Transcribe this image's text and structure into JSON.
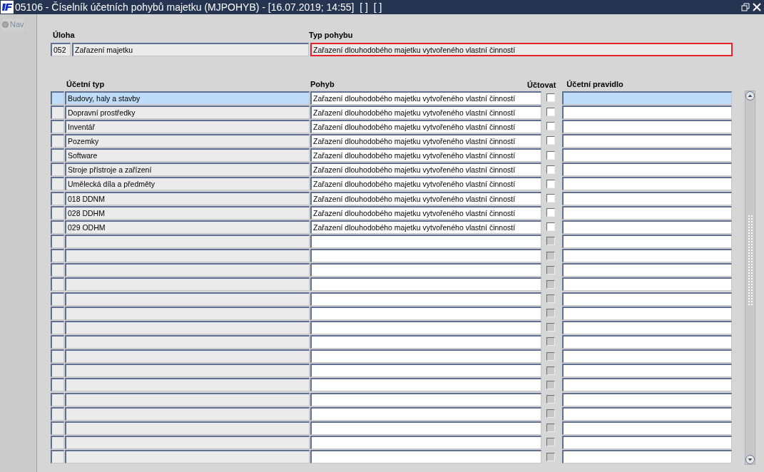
{
  "window": {
    "title": "05106 - Číselník účetních pohybů majetku (MJPOHYB) - [16.07.2019; 14:55]  [ ]  [ ]"
  },
  "sidebar": {
    "nav": {
      "label": "Nav",
      "selected": false
    }
  },
  "header": {
    "uloha_label": "Úloha",
    "uloha_code": "052",
    "uloha_name": "Zařazení majetku",
    "typ_label": "Typ pohybu",
    "typ_value": "Zařazení dlouhodobého majetku vytvořeného vlastní činností",
    "typ_focused": true
  },
  "table": {
    "columns": [
      "Účetní typ",
      "Pohyb",
      "Účtovat",
      "Účetní pravidlo"
    ],
    "rows": [
      {
        "typ": "Budovy, haly a stavby",
        "pohyb": "Zařazení dlouhodobého majetku vytvořeného vlastní činností",
        "checked": false,
        "disabled": false,
        "selected": true
      },
      {
        "typ": "Dopravní prostředky",
        "pohyb": "Zařazení dlouhodobého majetku vytvořeného vlastní činností",
        "checked": false,
        "disabled": false,
        "selected": false
      },
      {
        "typ": "Inventář",
        "pohyb": "Zařazení dlouhodobého majetku vytvořeného vlastní činností",
        "checked": false,
        "disabled": false,
        "selected": false
      },
      {
        "typ": "Pozemky",
        "pohyb": "Zařazení dlouhodobého majetku vytvořeného vlastní činností",
        "checked": false,
        "disabled": false,
        "selected": false
      },
      {
        "typ": "Software",
        "pohyb": "Zařazení dlouhodobého majetku vytvořeného vlastní činností",
        "checked": false,
        "disabled": false,
        "selected": false
      },
      {
        "typ": "Stroje přístroje a zařízení",
        "pohyb": "Zařazení dlouhodobého majetku vytvořeného vlastní činností",
        "checked": false,
        "disabled": false,
        "selected": false
      },
      {
        "typ": "Umělecká díla a předměty",
        "pohyb": "Zařazení dlouhodobého majetku vytvořeného vlastní činností",
        "checked": false,
        "disabled": false,
        "selected": false
      },
      {
        "typ": "018 DDNM",
        "pohyb": "Zařazení dlouhodobého majetku vytvořeného vlastní činností",
        "checked": false,
        "disabled": false,
        "selected": false
      },
      {
        "typ": "028 DDHM",
        "pohyb": "Zařazení dlouhodobého majetku vytvořeného vlastní činností",
        "checked": false,
        "disabled": false,
        "selected": false
      },
      {
        "typ": "029 ODHM",
        "pohyb": "Zařazení dlouhodobého majetku vytvořeného vlastní činností",
        "checked": false,
        "disabled": false,
        "selected": false
      },
      {
        "checked": false,
        "disabled": true,
        "selected": false
      },
      {
        "checked": false,
        "disabled": true,
        "selected": false
      },
      {
        "checked": false,
        "disabled": true,
        "selected": false
      },
      {
        "checked": false,
        "disabled": true,
        "selected": false
      },
      {
        "checked": false,
        "disabled": true,
        "selected": false
      },
      {
        "checked": false,
        "disabled": true,
        "selected": false
      },
      {
        "checked": false,
        "disabled": true,
        "selected": false
      },
      {
        "checked": false,
        "disabled": true,
        "selected": false
      },
      {
        "checked": false,
        "disabled": true,
        "selected": false
      },
      {
        "checked": false,
        "disabled": true,
        "selected": false
      },
      {
        "checked": false,
        "disabled": true,
        "selected": false
      },
      {
        "checked": false,
        "disabled": true,
        "selected": false
      },
      {
        "checked": false,
        "disabled": true,
        "selected": false
      },
      {
        "checked": false,
        "disabled": true,
        "selected": false
      },
      {
        "checked": false,
        "disabled": true,
        "selected": false
      },
      {
        "checked": false,
        "disabled": true,
        "selected": false
      }
    ]
  }
}
